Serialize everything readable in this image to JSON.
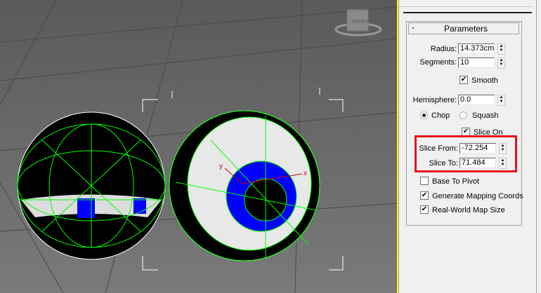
{
  "viewport": {
    "viewcube_label": "FRONT",
    "axis_x": "x",
    "axis_y": "y"
  },
  "parameters": {
    "title": "Parameters",
    "collapse": "-",
    "radius_label": "Radius:",
    "radius_value": "14.373cm",
    "segments_label": "Segments:",
    "segments_value": "10",
    "smooth_label": "Smooth",
    "smooth_checked": true,
    "hemisphere_label": "Hemisphere:",
    "hemisphere_value": "0.0",
    "chop_label": "Chop",
    "squash_label": "Squash",
    "selected_mode": "Chop",
    "slice_on_label": "Slice On",
    "slice_on_checked": true,
    "slice_from_label": "Slice From:",
    "slice_from_value": "-72.254",
    "slice_to_label": "Slice To:",
    "slice_to_value": "71.484",
    "base_to_pivot_label": "Base To Pivot",
    "base_to_pivot_checked": false,
    "gen_mapping_label": "Generate Mapping Coords",
    "gen_mapping_checked": true,
    "real_world_label": "Real-World Map Size",
    "real_world_checked": true
  },
  "colors": {
    "highlight": "#e8141c",
    "wire": "#00ff00",
    "inner": "#0000ff"
  }
}
